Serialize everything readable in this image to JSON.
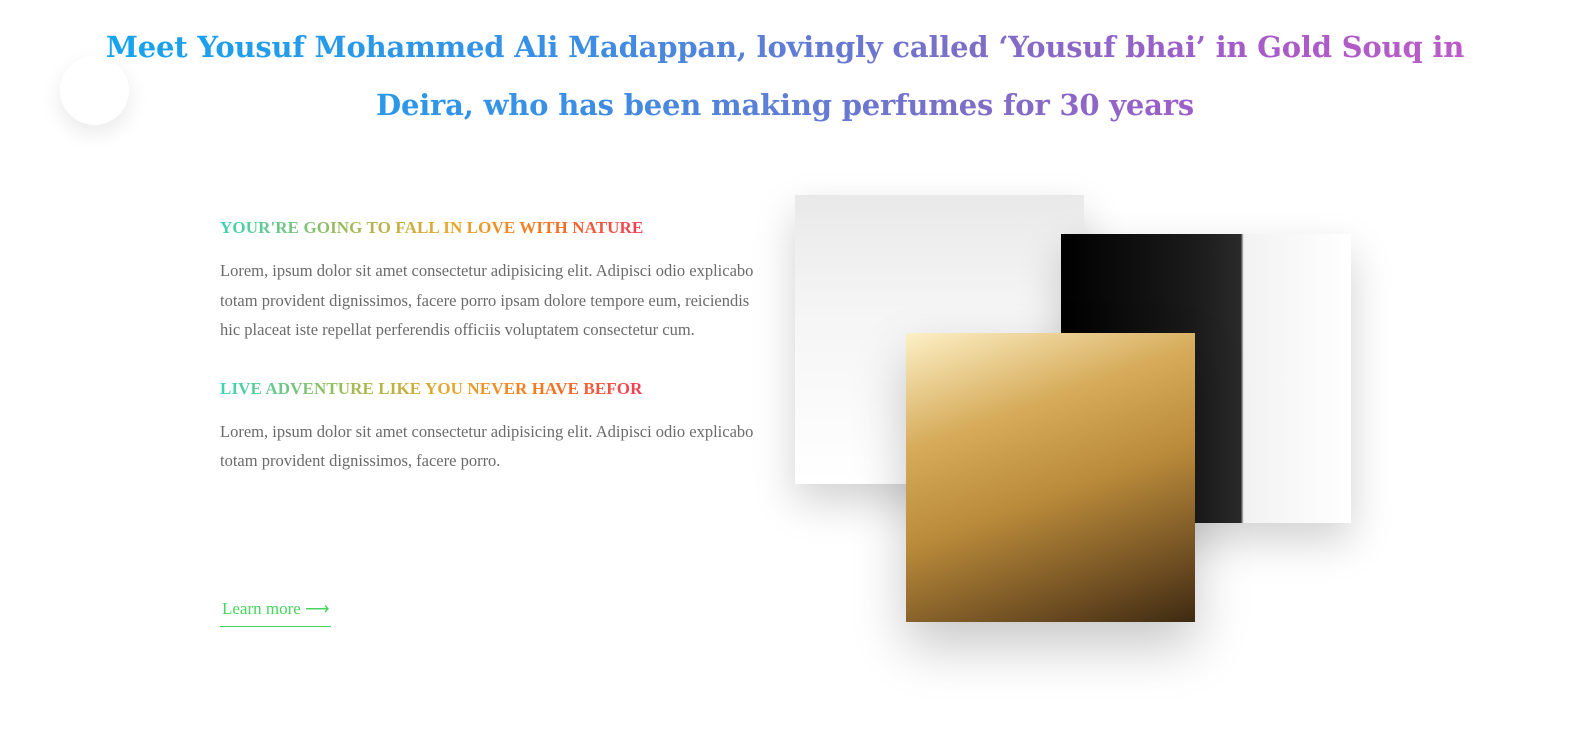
{
  "hero": {
    "headline": "Meet Yousuf Mohammed Ali Madappan, lovingly called ‘Yousuf bhai’ in Gold Souq in Deira, who has been making perfumes for 30 years"
  },
  "features": [
    {
      "title": "YOUR'RE GOING TO FALL IN LOVE WITH NATURE",
      "text": "Lorem, ipsum dolor sit amet consectetur adipisicing elit. Adipisci odio explicabo totam provident dignissimos, facere porro ipsam dolore tempore eum, reiciendis hic placeat iste repellat perferendis officiis voluptatem consectetur cum."
    },
    {
      "title": "LIVE ADVENTURE LIKE YOU NEVER HAVE BEFOR",
      "text": "Lorem, ipsum dolor sit amet consectetur adipisicing elit. Adipisci odio explicabo totam provident dignissimos, facere porro."
    }
  ],
  "cta": {
    "label": "Learn more ⟶"
  },
  "gallery": {
    "images": [
      {
        "name": "rose-perfume-image"
      },
      {
        "name": "black-perfume-image"
      },
      {
        "name": "gold-perfume-image"
      }
    ]
  },
  "colors": {
    "headline_gradient": [
      "#11a6ee",
      "#7b6fc8",
      "#c05cc6"
    ],
    "title_gradient": [
      "#3fd3b4",
      "#e8a62a",
      "#f23d56"
    ],
    "link": "#45d55c",
    "body_text": "#6b6b6b"
  }
}
